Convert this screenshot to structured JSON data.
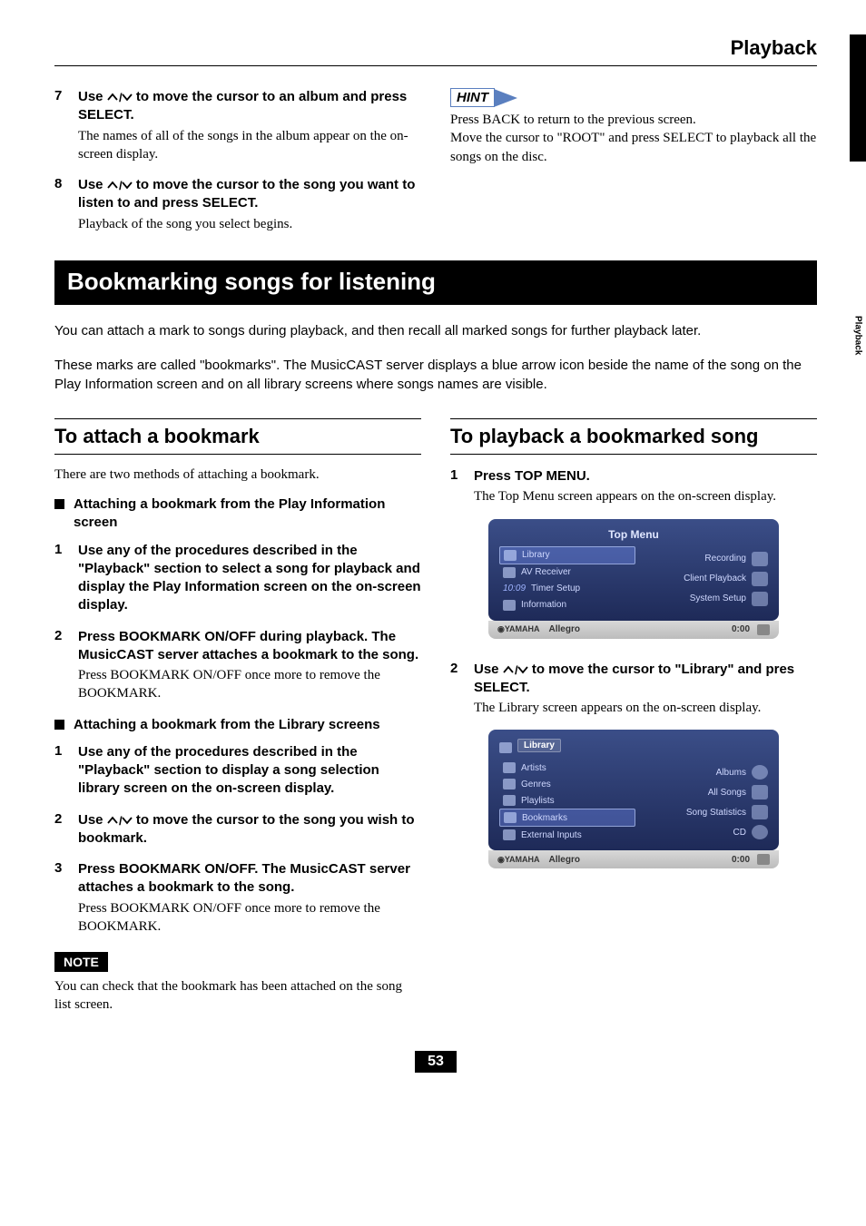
{
  "header": {
    "breadcrumb": "Playback"
  },
  "sideTab": {
    "label": "Playback"
  },
  "topSteps": {
    "s7": {
      "num": "7",
      "bold_pre": "Use ",
      "bold_post": " to move the cursor to an album and press SELECT.",
      "desc": "The names of all of the songs in the album appear on the on-screen display."
    },
    "s8": {
      "num": "8",
      "bold_pre": "Use ",
      "bold_post": " to move the cursor to the song you want to listen to and press SELECT.",
      "desc": "Playback of the song you select begins."
    }
  },
  "hint": {
    "label": "HINT",
    "line1": "Press BACK to return to the previous screen.",
    "line2": "Move the cursor to \"ROOT\" and press SELECT to playback all the songs on the disc."
  },
  "section": {
    "title": "Bookmarking songs for listening",
    "intro1": "You can attach a mark to songs during playback, and then recall all marked songs for further playback later.",
    "intro2": "These marks are called \"bookmarks\". The MusicCAST server displays a blue arrow icon beside the name of the song on the Play Information screen and on all library screens where songs names are visible."
  },
  "left": {
    "subhead": "To attach a bookmark",
    "lead": "There are two methods of attaching a bookmark.",
    "b1": "Attaching a bookmark from the Play Information screen",
    "s1": {
      "num": "1",
      "text": "Use any of the procedures described in the \"Playback\" section to select a song for playback and display the Play Information screen on the on-screen display."
    },
    "s2": {
      "num": "2",
      "text": "Press BOOKMARK ON/OFF during playback. The MusicCAST server attaches a bookmark to the song.",
      "desc": "Press BOOKMARK ON/OFF once more to remove the BOOKMARK."
    },
    "b2": "Attaching a bookmark from the Library screens",
    "s3": {
      "num": "1",
      "text": "Use any of the procedures described in the \"Playback\" section to display a song selection library screen on the on-screen display."
    },
    "s4": {
      "num": "2",
      "pre": "Use ",
      "post": " to move the cursor to the song you wish to bookmark."
    },
    "s5": {
      "num": "3",
      "text": "Press BOOKMARK ON/OFF. The MusicCAST server attaches a bookmark to the song.",
      "desc": "Press BOOKMARK ON/OFF once more to remove the BOOKMARK."
    },
    "noteLabel": "NOTE",
    "noteText": "You can check that the bookmark has been attached on the song list screen."
  },
  "right": {
    "subhead": "To playback a bookmarked song",
    "s1": {
      "num": "1",
      "bold": "Press TOP MENU.",
      "desc": "The Top Menu screen appears on the on-screen display."
    },
    "s2": {
      "num": "2",
      "pre": "Use ",
      "post": " to move the cursor to \"Library\" and pres SELECT.",
      "desc": "The Library screen appears on the on-screen display."
    }
  },
  "ui1": {
    "title": "Top Menu",
    "leftItems": [
      "Library",
      "AV Receiver",
      "Timer Setup",
      "Information"
    ],
    "time": "10:09",
    "rightItems": [
      "Recording",
      "Client Playback",
      "System Setup"
    ],
    "status": {
      "brand": "YAMAHA",
      "track": "Allegro",
      "time": "0:00"
    }
  },
  "ui2": {
    "crumb": "Library",
    "leftItems": [
      "Artists",
      "Genres",
      "Playlists",
      "Bookmarks",
      "External Inputs"
    ],
    "rightItems": [
      "Albums",
      "All Songs",
      "Song Statistics",
      "CD"
    ],
    "status": {
      "brand": "YAMAHA",
      "track": "Allegro",
      "time": "0:00"
    }
  },
  "pageNumber": "53"
}
